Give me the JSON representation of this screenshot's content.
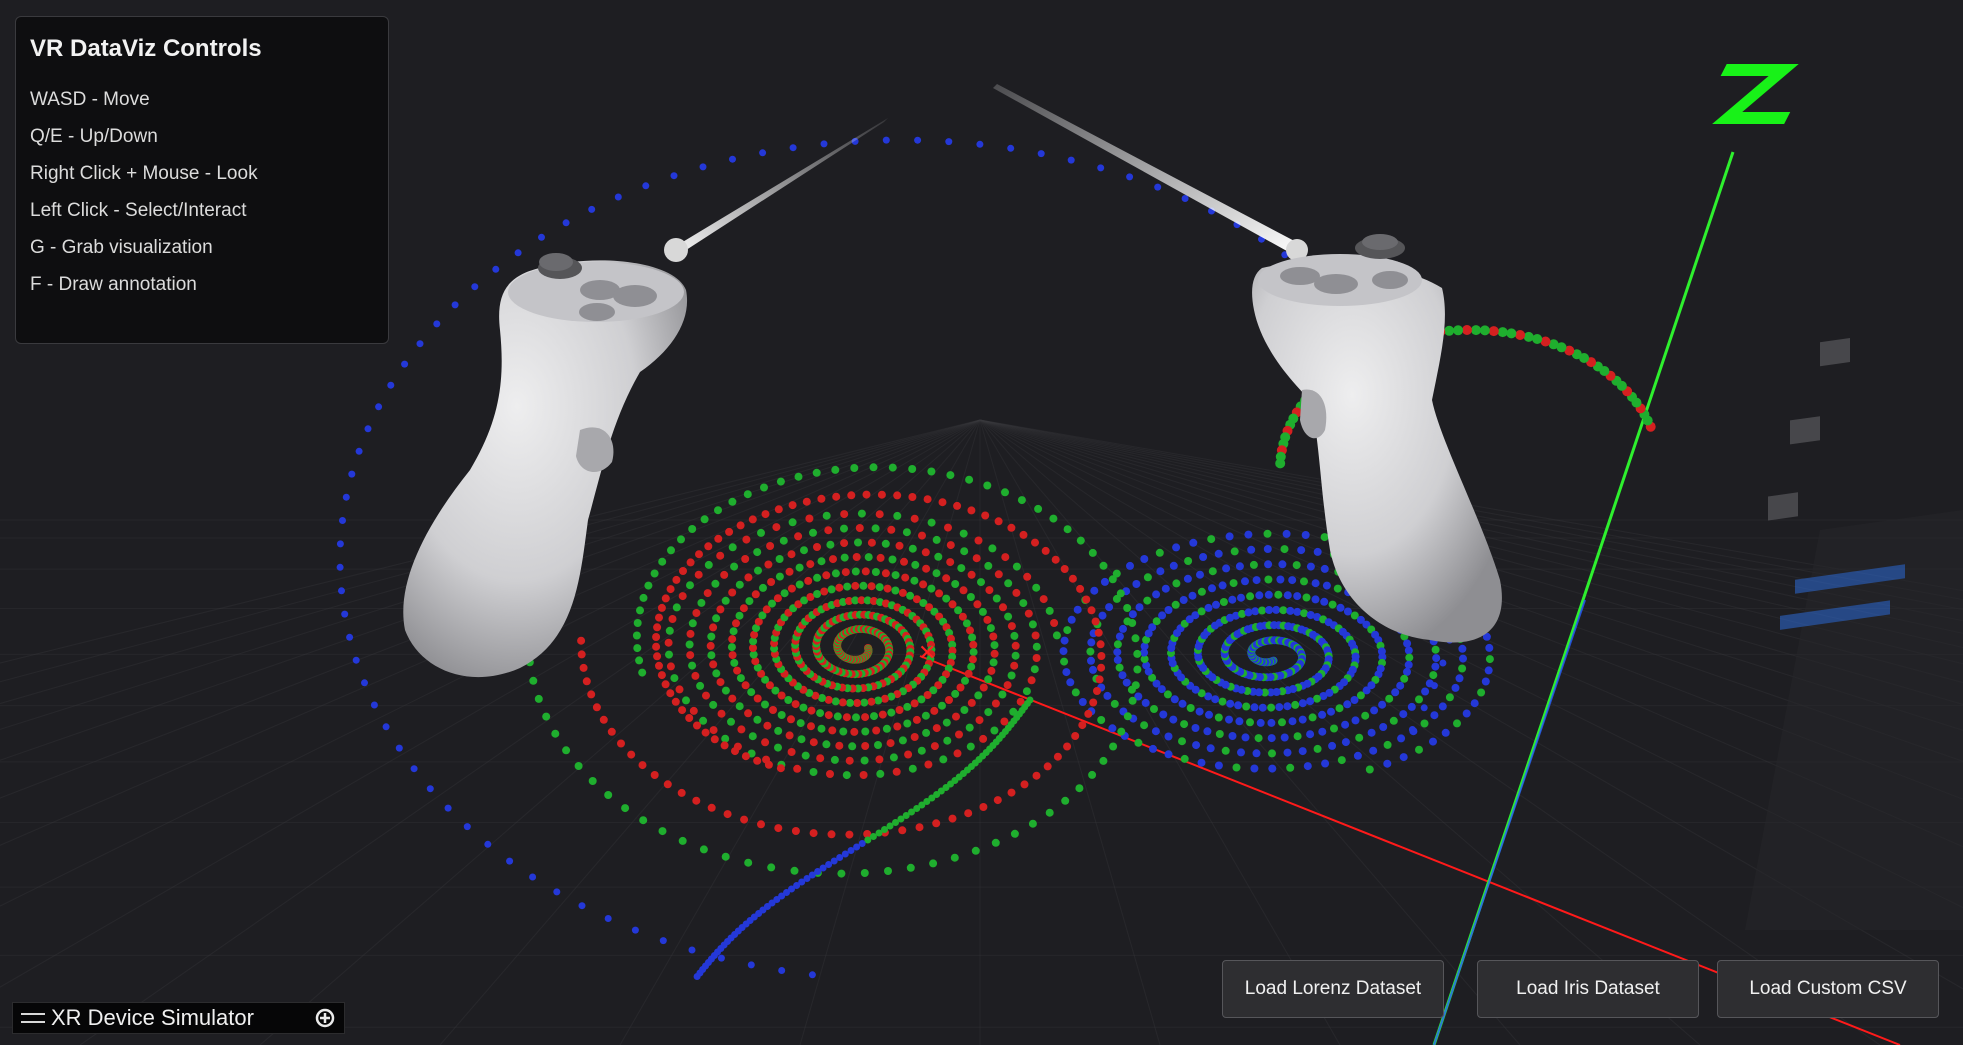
{
  "controls": {
    "title": "VR DataViz Controls",
    "items": [
      "WASD - Move",
      "Q/E - Up/Down",
      "Right Click + Mouse - Look",
      "Left Click - Select/Interact",
      "G - Grab visualization",
      "F - Draw annotation"
    ]
  },
  "buttons": {
    "lorenz": "Load Lorenz Dataset",
    "iris": "Load Iris Dataset",
    "csv": "Load Custom CSV"
  },
  "xr_simulator": {
    "label": "XR Device Simulator",
    "settings_icon": "settings-gear-icon"
  },
  "colors": {
    "background": "#1e1e22",
    "x_axis": "#ff1a1a",
    "y_axis": "#2ef02e",
    "z_axis": "#2a3cff",
    "point_red": "#d42020",
    "point_green": "#1fae2e",
    "point_blue": "#2438d8",
    "controller": "#d6d6d8"
  }
}
